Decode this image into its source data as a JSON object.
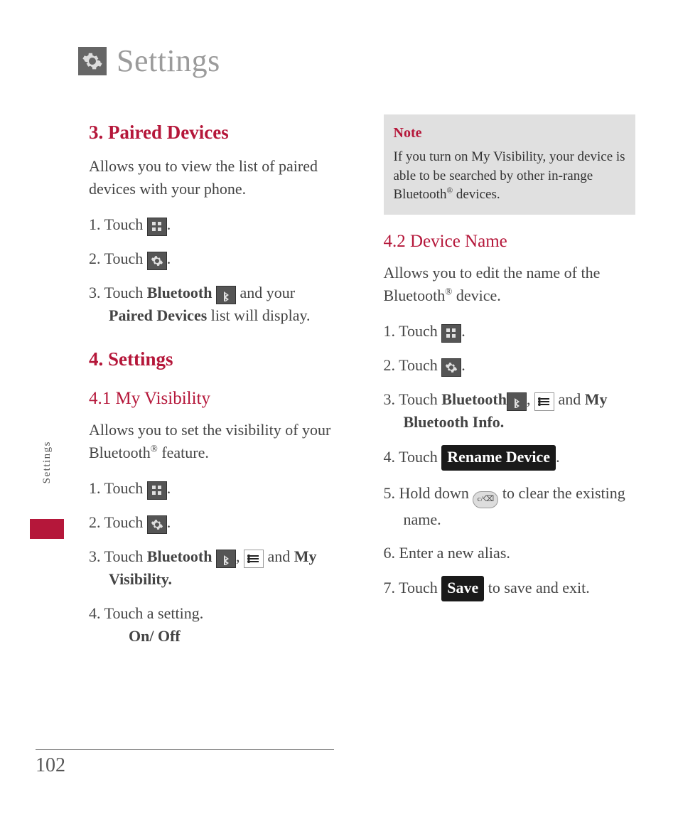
{
  "page": {
    "title": "Settings",
    "sideTab": "Settings",
    "number": "102"
  },
  "left": {
    "sec3": {
      "heading": "3. Paired Devices",
      "intro": "Allows you to view the list of paired devices with your phone.",
      "s1a": "1. Touch ",
      "s2a": "2. Touch ",
      "s3a": "3. Touch ",
      "s3bold1": "Bluetooth",
      "s3b": " and your ",
      "s3bold2": "Paired Devices",
      "s3c": " list will display.",
      "dot": "."
    },
    "sec4": {
      "heading": "4. Settings",
      "sub41": "4.1 My Visibility",
      "intro41": "Allows you to set the visibility of your Bluetooth",
      "intro41b": " feature.",
      "s1a": "1. Touch ",
      "s2a": "2. Touch ",
      "s3a": "3. Touch ",
      "s3bold1": "Bluetooth",
      "s3mid": ", ",
      "s3b": " and ",
      "s3bold2": "My Visibility.",
      "s4a": "4. Touch a setting.",
      "s4b": "On/ Off",
      "dot": "."
    }
  },
  "right": {
    "note": {
      "title": "Note",
      "body1": "If you turn on My Visibility, your device is able to be searched by other in-range Bluetooth",
      "body2": " devices."
    },
    "sec42": {
      "heading": "4.2 Device Name",
      "intro1": "Allows you to edit the name of the Bluetooth",
      "intro2": " device.",
      "s1a": "1. Touch ",
      "s2a": "2. Touch ",
      "s3a": "3. Touch ",
      "s3bold1": "Bluetooth",
      "s3mid": ", ",
      "s3b": " and ",
      "s3bold2": "My Bluetooth Info.",
      "s4a": "4. Touch ",
      "s4btn": "Rename Device",
      "s5a": "5. Hold down ",
      "s5b": " to clear the existing name.",
      "s6": "6. Enter a new alias.",
      "s7a": "7. Touch ",
      "s7btn": "Save",
      "s7b": " to save and exit.",
      "dot": "."
    }
  },
  "reg": "®"
}
